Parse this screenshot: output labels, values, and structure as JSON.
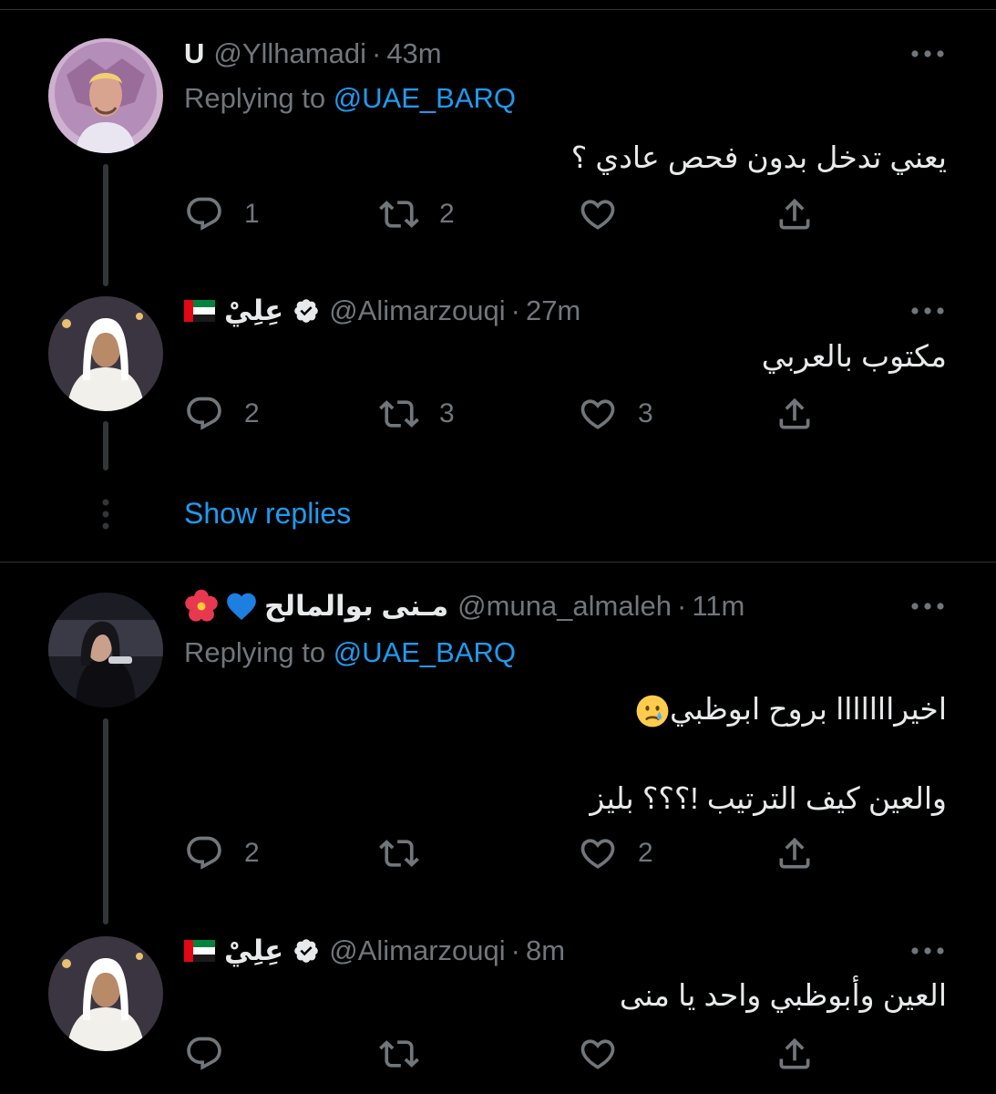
{
  "tweets": [
    {
      "name": "U",
      "handle": "@Yllhamadi",
      "dot": "·",
      "time": "43m",
      "replying_prefix": "Replying to ",
      "replying_to": "@UAE_BARQ",
      "text_lines": [
        "يعني تدخل بدون فحص عادي ؟"
      ],
      "reply_count": "1",
      "retweet_count": "2",
      "like_count": ""
    },
    {
      "name": "عِلِيْ",
      "flag": "uae-flag-emoji",
      "verified_icon": "verified-badge-icon",
      "handle": "@Alimarzouqi",
      "dot": "·",
      "time": "27m",
      "text_lines": [
        "مكتوب بالعربي"
      ],
      "reply_count": "2",
      "retweet_count": "3",
      "like_count": "3"
    },
    {
      "name": "مـنى بوالمالح",
      "name_emojis": [
        "blue-heart-emoji",
        "hibiscus-emoji"
      ],
      "handle": "@muna_almaleh",
      "dot": "·",
      "time": "11m",
      "replying_prefix": "Replying to ",
      "replying_to": "@UAE_BARQ",
      "text_lines": [
        "اخيرااااااا  بروح ابوظبي",
        "والعين كيف الترتيب !؟؟؟ بليز"
      ],
      "text_emoji": "crying-face-emoji",
      "reply_count": "2",
      "retweet_count": "",
      "like_count": "2"
    },
    {
      "name": "عِلِيْ",
      "flag": "uae-flag-emoji",
      "verified_icon": "verified-badge-icon",
      "handle": "@Alimarzouqi",
      "dot": "·",
      "time": "8m",
      "text_lines": [
        "العين وأبوظبي واحد يا منى"
      ],
      "reply_count": "",
      "retweet_count": "",
      "like_count": ""
    }
  ],
  "show_replies": "Show replies",
  "colors": {
    "background": "#000000",
    "text": "#e7e9ea",
    "muted": "#71767b",
    "link": "#1d9bf0",
    "divider": "#2f3336"
  }
}
